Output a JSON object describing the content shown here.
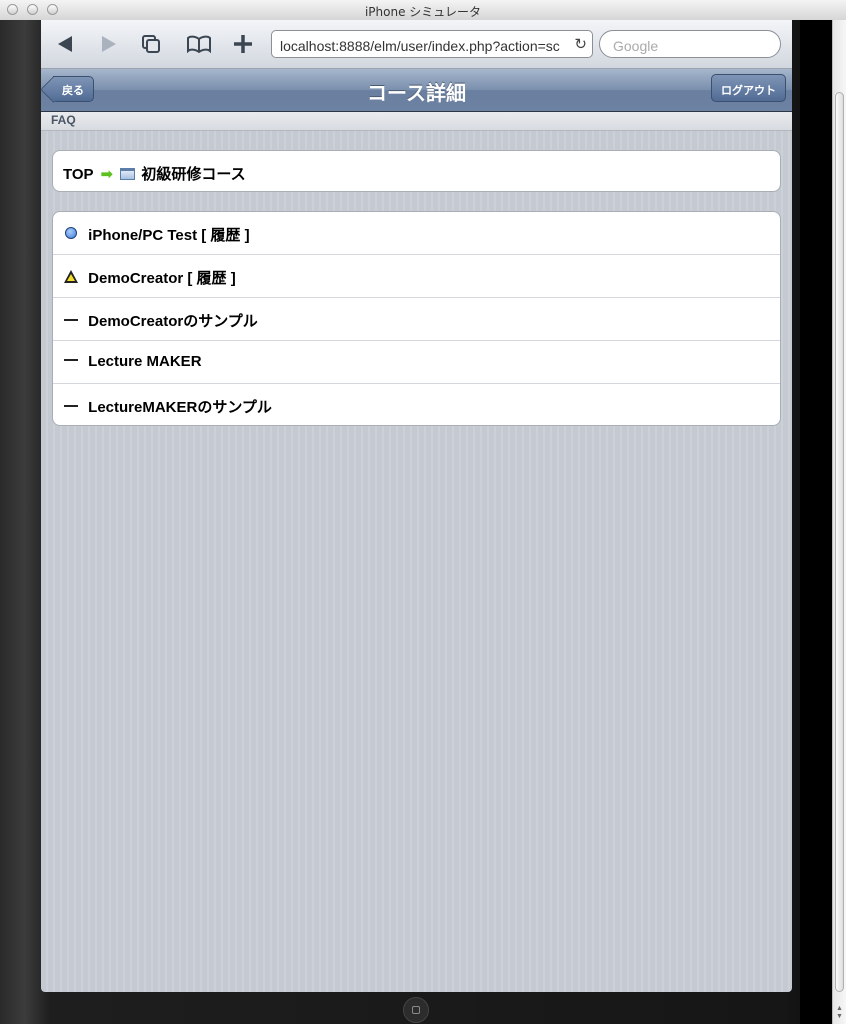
{
  "window": {
    "title": "iPhone シミュレータ"
  },
  "page_title_peek": "コース詳細",
  "toolbar": {
    "url": "localhost:8888/elm/user/index.php?action=sc",
    "search_placeholder": "Google"
  },
  "nav": {
    "back_label": "戻る",
    "title": "コース詳細",
    "logout_label": "ログアウト"
  },
  "faq_label": "FAQ",
  "breadcrumb": {
    "top": "TOP",
    "course": "初級研修コース"
  },
  "items": [
    {
      "label": "iPhone/PC Test [ 履歴 ]",
      "icon": "circle-icon"
    },
    {
      "label": "DemoCreator [ 履歴 ]",
      "icon": "triangle-warning-icon"
    },
    {
      "label": "DemoCreatorのサンプル",
      "icon": "dash-icon"
    },
    {
      "label": "Lecture MAKER",
      "icon": "dash-icon"
    },
    {
      "label": "LectureMAKERのサンプル",
      "icon": "dash-icon"
    }
  ]
}
